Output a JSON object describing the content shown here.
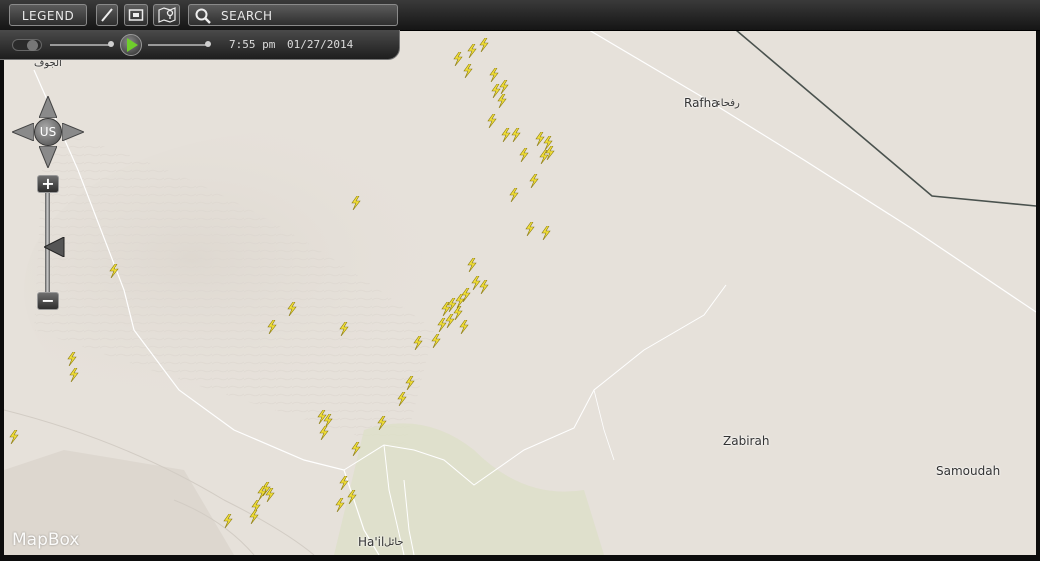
{
  "toolbar": {
    "legend_label": "LEGEND",
    "search_label": "SEARCH",
    "icons": [
      "pencil-icon",
      "layers-icon",
      "map-pin-icon",
      "search-icon"
    ]
  },
  "timebar": {
    "time": "7:55 pm",
    "date": "01/27/2014"
  },
  "nav": {
    "pan_center_label": "US",
    "zoom_in_label": "+",
    "zoom_out_label": "−"
  },
  "map": {
    "labels": {
      "rafha_en": "Rafha",
      "rafha_ar": "رفحاء",
      "aljawf_ar": "الجوف",
      "zabirah": "Zabirah",
      "samoudah": "Samoudah",
      "hail_en": "Ha'il",
      "hail_ar": "حائل"
    },
    "attribution": "MapBox",
    "colors": {
      "land": "#e6e1da",
      "strike": "#f4e23a",
      "border": "#4a524e",
      "road": "#ffffff"
    }
  }
}
